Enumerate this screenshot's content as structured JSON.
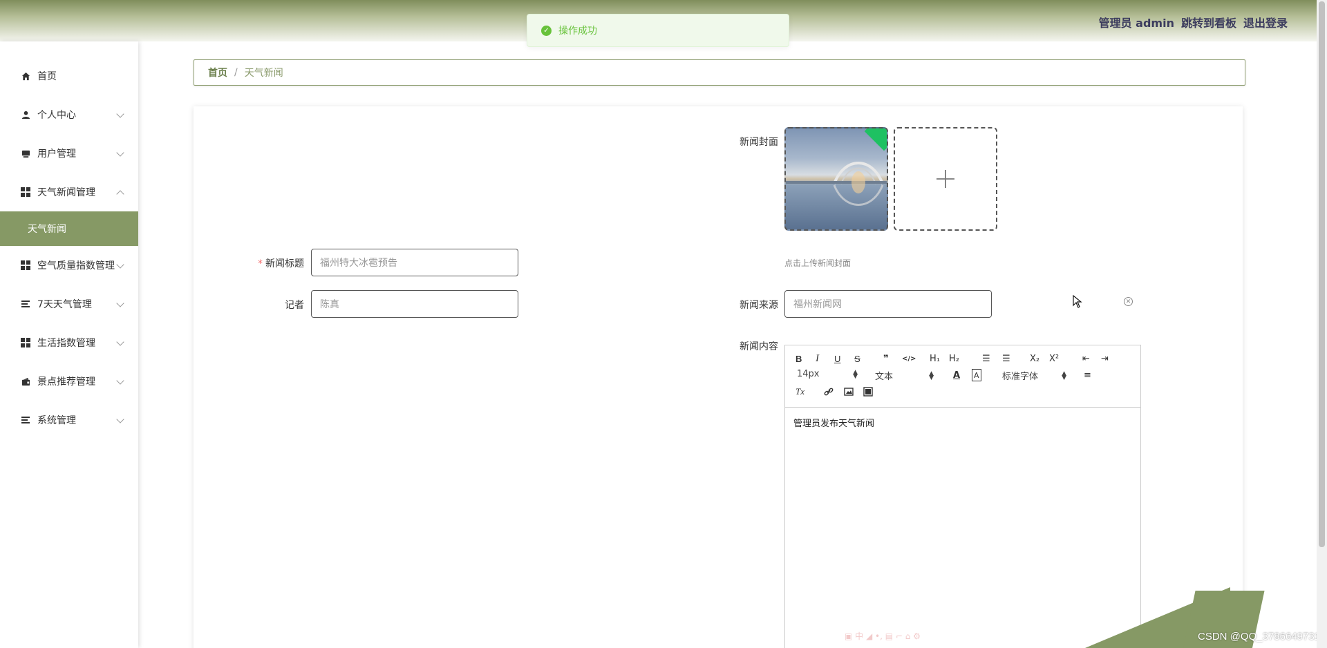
{
  "header": {
    "admin_label": "管理员 admin",
    "board_link": "跳转到看板",
    "logout": "退出登录"
  },
  "toast": {
    "message": "操作成功"
  },
  "sidebar": {
    "items": [
      {
        "label": "首页",
        "icon": "home-icon"
      },
      {
        "label": "个人中心",
        "icon": "user-icon"
      },
      {
        "label": "用户管理",
        "icon": "monitor-icon"
      },
      {
        "label": "天气新闻管理",
        "icon": "grid-icon",
        "expanded": true
      },
      {
        "label": "天气新闻",
        "sub": true,
        "active": true
      },
      {
        "label": "空气质量指数管理",
        "icon": "grid-icon"
      },
      {
        "label": "7天天气管理",
        "icon": "list-icon"
      },
      {
        "label": "生活指数管理",
        "icon": "grid-icon"
      },
      {
        "label": "景点推荐管理",
        "icon": "wallet-icon"
      },
      {
        "label": "系统管理",
        "icon": "list-icon"
      }
    ]
  },
  "breadcrumb": {
    "home": "首页",
    "separator": "/",
    "current": "天气新闻"
  },
  "form": {
    "title_label": "新闻标题",
    "title_value": "福州特大冰雹预告",
    "reporter_label": "记者",
    "reporter_value": "陈真",
    "cover_label": "新闻封面",
    "cover_hint": "点击上传新闻封面",
    "source_label": "新闻来源",
    "source_value": "福州新闻网",
    "content_label": "新闻内容"
  },
  "editor": {
    "toolbar": {
      "bold": "B",
      "italic": "I",
      "underline": "U",
      "strike": "S",
      "quote": "❞",
      "code": "</>",
      "h1": "H₁",
      "h2": "H₂",
      "ol": "☰",
      "ul": "☰",
      "sub": "X₂",
      "sup": "X²",
      "outdent": "⇤",
      "indent": "⇥",
      "size": "14px",
      "format": "文本",
      "font": "标准字体",
      "clear": "Tx"
    },
    "content": "管理员发布天气新闻"
  },
  "watermark": "CSDN @QQ_3786649731",
  "colors": {
    "accent": "#869965",
    "success": "#67c23a",
    "danger": "#f56c6c"
  }
}
